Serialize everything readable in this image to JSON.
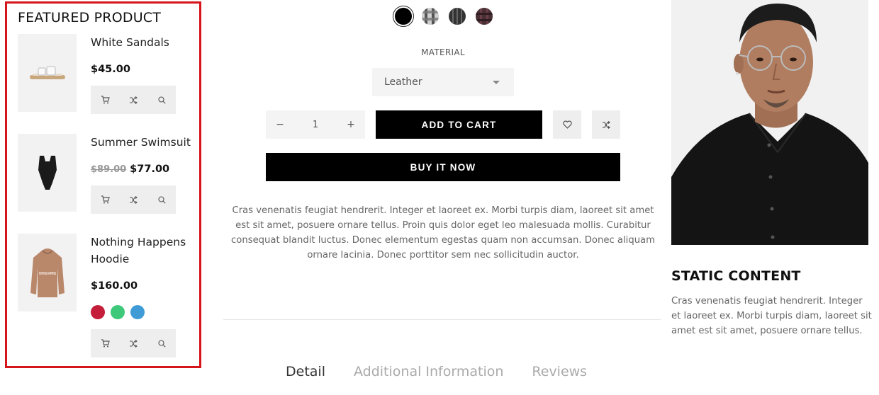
{
  "featured": {
    "title": "FEATURED PRODUCT",
    "products": [
      {
        "name": "White Sandals",
        "price": "$45.00",
        "old_price": ""
      },
      {
        "name": "Summer Swimsuit",
        "price": "$77.00",
        "old_price": "$89.00"
      },
      {
        "name": "Nothing Happens Hoodie",
        "price": "$160.00",
        "old_price": "",
        "swatches": [
          "#c41e3a",
          "#3ec97a",
          "#3f9bd6"
        ],
        "print_text": "NOTHING HAPPENS"
      }
    ]
  },
  "options": {
    "colors": [
      "#000000",
      "#8a8a8a",
      "#3a3a3a",
      "#4a2f35"
    ],
    "material_label": "MATERIAL",
    "material_value": "Leather",
    "quantity": "1",
    "minus": "−",
    "plus": "+",
    "add_to_cart": "ADD TO CART",
    "buy_now": "BUY IT NOW"
  },
  "description": "Cras venenatis feugiat hendrerit. Integer et laoreet ex. Morbi turpis diam, laoreet sit amet est sit amet, posuere ornare tellus. Proin quis dolor eget leo malesuada mollis. Curabitur consequat blandit luctus. Donec elementum egestas quam non accumsan. Donec aliquam ornare lacinia. Donec porttitor sem nec sollicitudin auctor.",
  "tabs": [
    "Detail",
    "Additional Information",
    "Reviews"
  ],
  "static": {
    "title": "STATIC CONTENT",
    "text": "Cras venenatis feugiat hendrerit. Integer et laoreet ex. Morbi turpis diam, laoreet sit amet est sit amet, posuere ornare tellus."
  },
  "colors": {
    "accent_border": "#d6141c",
    "button_bg": "#000000"
  }
}
